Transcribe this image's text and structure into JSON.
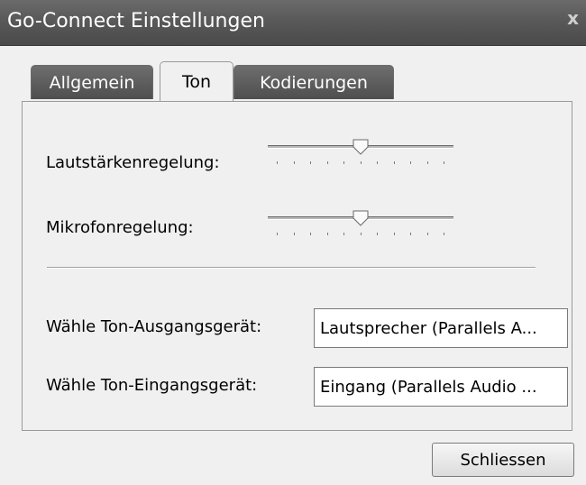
{
  "window": {
    "title": "Go-Connect Einstellungen",
    "close_glyph": "x"
  },
  "tabs": [
    {
      "label": "Allgemein",
      "active": false
    },
    {
      "label": "Ton",
      "active": true
    },
    {
      "label": "Kodierungen",
      "active": false
    }
  ],
  "audio": {
    "volume_label": "Lautstärkenregelung:",
    "volume_level": 0.5,
    "mic_label": "Mikrofonregelung:",
    "mic_level": 0.5,
    "tick_count": 11,
    "output_label": "Wähle Ton-Ausgangsgerät:",
    "output_value": "Lautsprecher (Parallels A...",
    "input_label": "Wähle Ton-Eingangsgerät:",
    "input_value": "Eingang (Parallels Audio ..."
  },
  "buttons": {
    "close_label": "Schliessen"
  },
  "colors": {
    "titlebar": "#595959",
    "tab_inactive": "#5e5e5e",
    "panel_bg": "#f0f0f0"
  }
}
